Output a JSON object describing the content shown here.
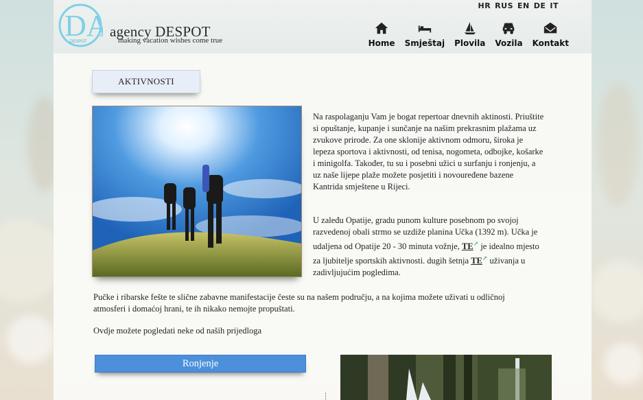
{
  "header": {
    "brand": "agency DESPOT",
    "tagline": "making vacation wishes come true",
    "logo_letters": "DA",
    "logo_small": "DESPOT"
  },
  "languages": [
    "HR",
    "RUS",
    "EN",
    "DE",
    "IT"
  ],
  "nav": [
    {
      "label": "Home",
      "icon": "home-icon"
    },
    {
      "label": "Smještaj",
      "icon": "bed-icon"
    },
    {
      "label": "Plovila",
      "icon": "sailboat-icon"
    },
    {
      "label": "Vozila",
      "icon": "car-icon"
    },
    {
      "label": "Kontakt",
      "icon": "envelope-icon"
    }
  ],
  "section": {
    "title": "AKTIVNOSTI"
  },
  "content": {
    "p1": "Na raspolaganju Vam je bogat repertoar dnevnih aktinosti. Priuštite si opuštanje, kupanje i sunčanje na našim prekrasnim plažama uz zvukove prirode. Za one sklonije aktivnom odmoru, široka je lepeza sportova i aktivnosti, od tenisa, nogometa, odbojke, košarke i minigolfa. Također, tu su i posebni užici u surfanju i ronjenju, a uz naše lijepe plaže možete posjetiti i novouređene bazene Kantrida smještene u Rijeci.",
    "p2_a": "U zaleđu Opatije, gradu punom kulture posebnom po svojoj razvedenoj obali strmo se uzdiže planina Učka (1392 m). Učka je udaljena od Opatije 20 - 30 minuta vožnje, ",
    "p2_link1": "TE",
    "p2_b": " je idealno mjesto za ljubitelje sportskih aktivnosti. dugih šetnja ",
    "p2_link2": "TE",
    "p2_c": " uživanja u zadivljujućim pogledima.",
    "p3": "Pučke i ribarske fešte te slične zabavne manifestacije česte su na našem području, a na kojima možete uživati u odličnoj atmosferi i domaćoj hrani, te ih nikako nemojte propuštati.",
    "p4": "Ovdje možete pogledati neke od naših prijedloga"
  },
  "buttons": {
    "ronjenje": "Ronjenje"
  },
  "colors": {
    "accent_blue": "#4c8fdb",
    "link_green": "#3aa86a",
    "logo_cyan": "#7fd0e6"
  }
}
